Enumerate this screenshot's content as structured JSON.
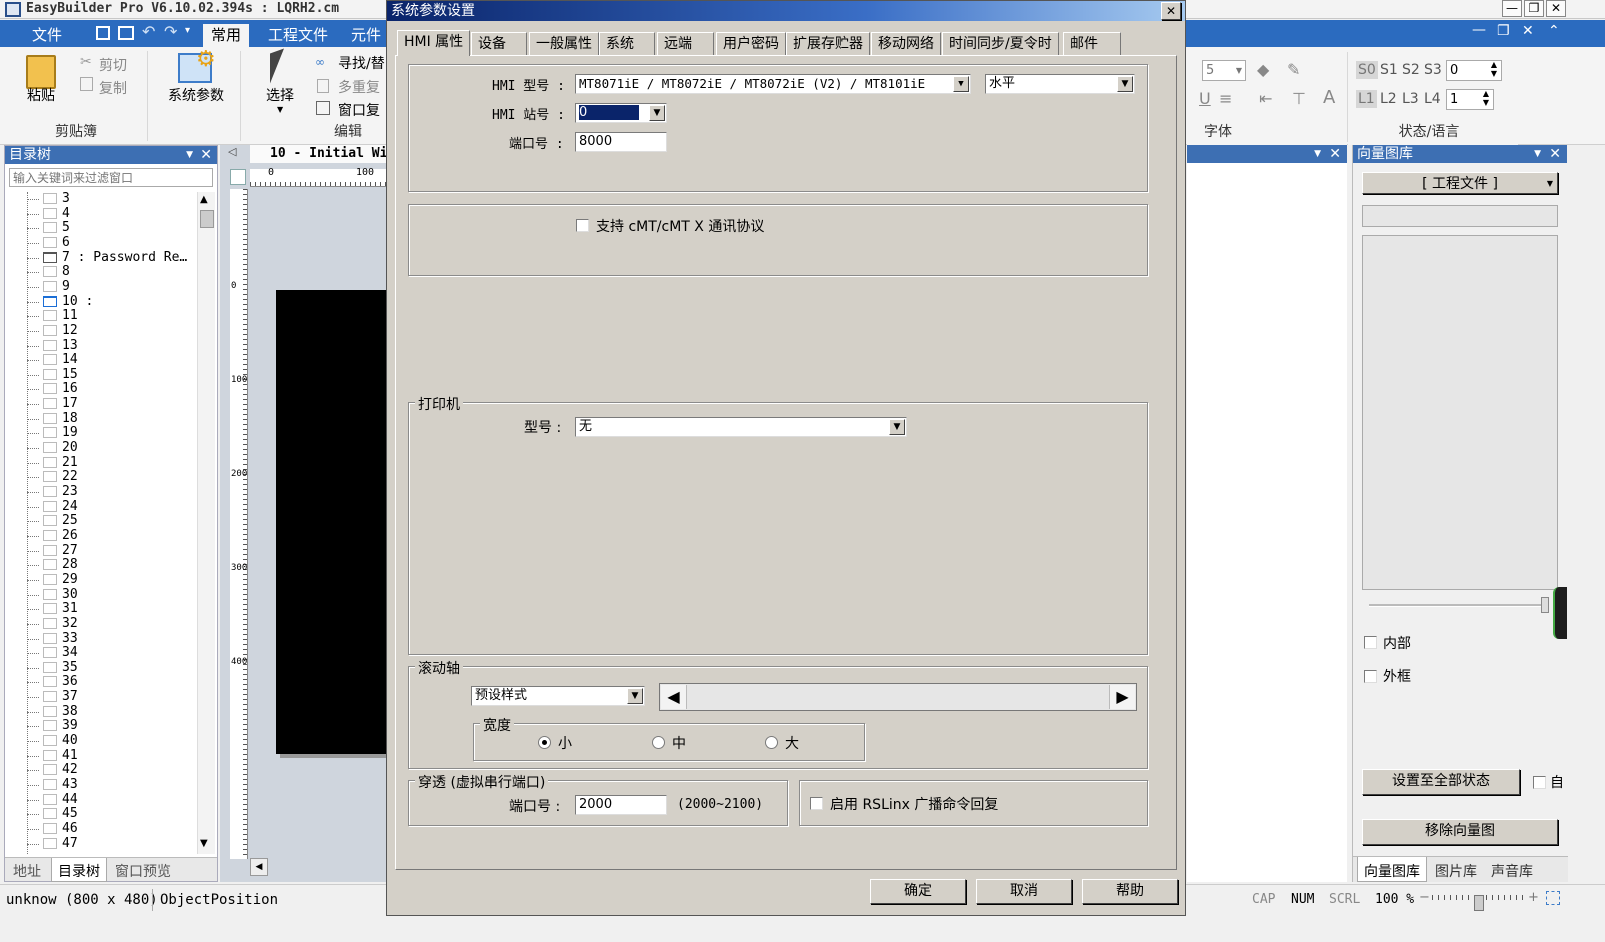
{
  "app": {
    "title": "EasyBuilder Pro V6.10.02.394s : LQRH2.cm",
    "window_controls": [
      "—",
      "❐",
      "✕"
    ]
  },
  "ribbon": {
    "tabs": [
      "文件",
      "常用",
      "工程文件",
      "元件"
    ],
    "clipboard": {
      "paste": "粘贴",
      "cut": "剪切",
      "copy": "复制",
      "group": "剪贴簿"
    },
    "sysparam": "系统参数",
    "edit": {
      "select": "选择",
      "find": "寻找/替",
      "multi_copy": "多重复",
      "window_copy": "窗口复",
      "group": "编辑"
    },
    "font_group": "字体",
    "font_size": "5",
    "state_group": "状态/语言",
    "states": [
      "S0",
      "S1",
      "S2",
      "S3"
    ],
    "state_value": "0",
    "languages": [
      "L1",
      "L2",
      "L3",
      "L4"
    ],
    "lang_value": "1"
  },
  "left_panel": {
    "title": "目录树",
    "filter_placeholder": "输入关键词来过滤窗口",
    "items": [
      "3",
      "4",
      "5",
      "6",
      "7 : Password Re…",
      "8",
      "9",
      "10 :",
      "11",
      "12",
      "13",
      "14",
      "15",
      "16",
      "17",
      "18",
      "19",
      "20",
      "21",
      "22",
      "23",
      "24",
      "25",
      "26",
      "27",
      "28",
      "29",
      "30",
      "31",
      "32",
      "33",
      "34",
      "35",
      "36",
      "37",
      "38",
      "39",
      "40",
      "41",
      "42",
      "43",
      "44",
      "45",
      "46",
      "47"
    ],
    "bottom_tabs": [
      "地址",
      "目录树",
      "窗口预览"
    ]
  },
  "editor": {
    "tab": "10 - Initial Wi",
    "ruler_h": [
      "0",
      "100"
    ],
    "ruler_v": [
      "0",
      "100",
      "200",
      "300",
      "400"
    ]
  },
  "vector_panel": {
    "title": "向量图库",
    "dropdown": "[ 工程文件 ]",
    "inner": "内部",
    "outer": "外框",
    "apply_all": "设置至全部状态",
    "auto": "自",
    "remove": "移除向量图",
    "bottom_tabs": [
      "向量图库",
      "图片库",
      "声音库"
    ]
  },
  "dialog": {
    "title": "系统参数设置",
    "close": "✕",
    "tabs": [
      "HMI 属性",
      "设备",
      "一般属性",
      "系统",
      "远端",
      "用户密码",
      "扩展存贮器",
      "移动网络",
      "时间同步/夏令时",
      "邮件"
    ],
    "hmi_model_label": "HMI 型号 :",
    "hmi_model": "MT8071iE / MT8072iE / MT8072iE (V2) / MT8101iE",
    "orientation": "水平",
    "station_label": "HMI 站号 :",
    "station": "0",
    "port_label": "端口号 :",
    "port": "8000",
    "cmt_support": "支持 cMT/cMT X 通讯协议",
    "printer_group": "打印机",
    "printer_model_label": "型号 :",
    "printer_model": "无",
    "scroll_group": "滚动轴",
    "scroll_style": "预设样式",
    "width_group": "宽度",
    "width_small": "小",
    "width_mid": "中",
    "width_large": "大",
    "passthrough_group": "穿透 (虚拟串行端口)",
    "pt_port_label": "端口号 :",
    "pt_port": "2000",
    "pt_range": "(2000~2100)",
    "rslinx": "启用 RSLinx 广播命令回复",
    "ok": "确定",
    "cancel": "取消",
    "help": "帮助"
  },
  "statusbar": {
    "left": "unknow (800 x 480)",
    "position": "ObjectPosition",
    "cap": "CAP",
    "num": "NUM",
    "scrl": "SCRL",
    "zoom": "100 %"
  }
}
